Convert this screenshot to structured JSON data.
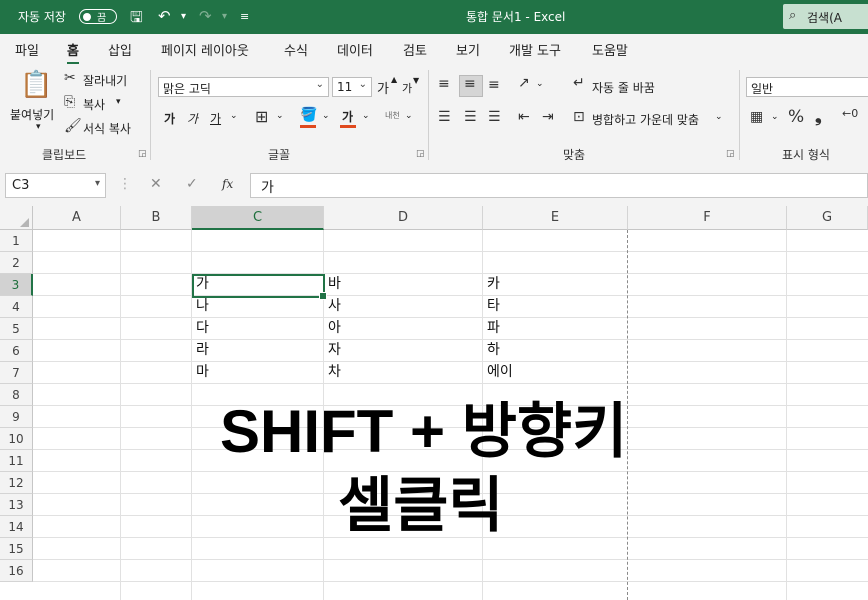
{
  "titlebar": {
    "autosave_label": "자동 저장",
    "autosave_state": "끔",
    "doc_title": "통합 문서1  -  Excel",
    "search_label": "검색(A"
  },
  "tabs": [
    "파일",
    "홈",
    "삽입",
    "페이지 레이아웃",
    "수식",
    "데이터",
    "검토",
    "보기",
    "개발 도구",
    "도움말"
  ],
  "active_tab": "홈",
  "ribbon": {
    "clipboard": {
      "paste": "붙여넣기",
      "cut": "잘라내기",
      "copy": "복사",
      "format_painter": "서식 복사",
      "group": "클립보드"
    },
    "font": {
      "name": "맑은 고딕",
      "size": "11",
      "bold": "가",
      "italic": "가",
      "underline": "가",
      "fill_glyph": "가",
      "grow": "가",
      "shrink": "가",
      "phonetic": "내천",
      "group": "글꼴"
    },
    "alignment": {
      "wrap": "자동 줄 바꿈",
      "merge": "병합하고 가운데 맞춤",
      "group": "맞춤"
    },
    "number": {
      "format": "일반",
      "group": "표시 형식"
    }
  },
  "formula_bar": {
    "name_box": "C3",
    "fx": "fx",
    "content": "가"
  },
  "columns": [
    "A",
    "B",
    "C",
    "D",
    "E",
    "F",
    "G"
  ],
  "rows": [
    "1",
    "2",
    "3",
    "4",
    "5",
    "6",
    "7",
    "8",
    "9",
    "10",
    "11",
    "12",
    "13",
    "14",
    "15",
    "16"
  ],
  "cells": {
    "C3": "가",
    "C4": "나",
    "C5": "다",
    "C6": "라",
    "C7": "마",
    "D3": "바",
    "D4": "사",
    "D5": "아",
    "D6": "자",
    "D7": "차",
    "E3": "카",
    "E4": "타",
    "E5": "파",
    "E6": "하",
    "E7": "에이"
  },
  "overlay": {
    "line1": "SHIFT + 방향키",
    "line2": "셀클릭"
  },
  "colors": {
    "accent": "#217346",
    "ribbon_bg": "#f3f3f3"
  }
}
